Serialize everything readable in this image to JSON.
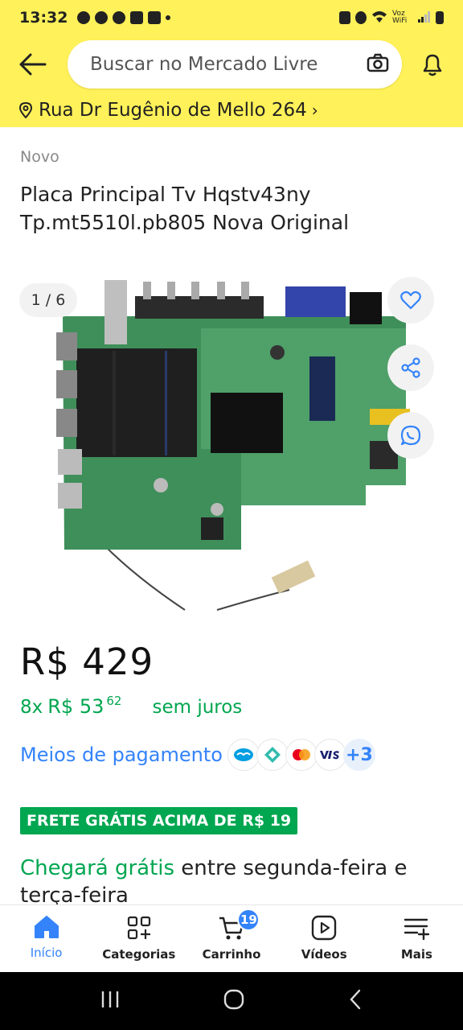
{
  "status_bar": {
    "time": "13:32",
    "network_label": "Voz WiFi"
  },
  "header": {
    "search_placeholder": "Buscar no Mercado Livre"
  },
  "address": {
    "text": "Rua Dr Eugênio de Mello 264"
  },
  "product": {
    "condition": "Novo",
    "title": "Placa Principal Tv Hqstv43ny Tp.mt5510l.pb805 Nova Original",
    "gallery_counter": "1 / 6",
    "price": "R$ 429",
    "installments": {
      "count": "8x",
      "currency": "R$ 53",
      "cents": "62",
      "suffix": "sem juros"
    },
    "payment_link": "Meios de pagamento",
    "payment_methods": [
      "mercado-pago",
      "pix",
      "mastercard",
      "visa"
    ],
    "payment_more": "+3",
    "shipping_badge": "FRETE GRÁTIS ACIMA DE R$ 19",
    "delivery": {
      "highlight": "Chegará grátis",
      "rest": " entre segunda-feira e terça-feira"
    }
  },
  "bottom_nav": {
    "items": [
      {
        "label": "Início",
        "icon": "home-icon"
      },
      {
        "label": "Categorias",
        "icon": "categories-icon"
      },
      {
        "label": "Carrinho",
        "icon": "cart-icon",
        "badge": "19"
      },
      {
        "label": "Vídeos",
        "icon": "video-icon"
      },
      {
        "label": "Mais",
        "icon": "menu-icon"
      }
    ]
  },
  "colors": {
    "brand_yellow": "#fff159",
    "accent_blue": "#3483fa",
    "green": "#00a650"
  }
}
